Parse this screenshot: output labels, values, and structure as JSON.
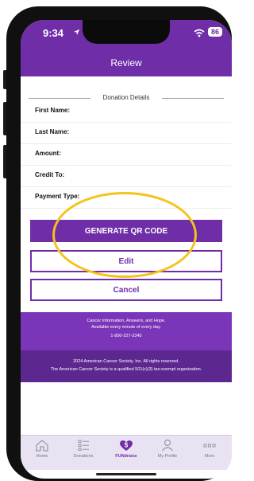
{
  "status_bar": {
    "time": "9:34",
    "battery": "86"
  },
  "header": {
    "title": "Review"
  },
  "section": {
    "title": "Donation Details"
  },
  "fields": [
    {
      "label": "First Name:",
      "value": ""
    },
    {
      "label": "Last Name:",
      "value": ""
    },
    {
      "label": "Amount:",
      "value": ""
    },
    {
      "label": "Credit To:",
      "value": ""
    },
    {
      "label": "Payment Type:",
      "value": ""
    }
  ],
  "buttons": {
    "generate_qr": "GENERATE QR CODE",
    "edit": "Edit",
    "cancel": "Cancel"
  },
  "footer": {
    "line1": "Cancer Information, Answers, and Hope.",
    "line2": "Available every minute of every day.",
    "phone": "1-800-227-2345",
    "copyright": "2024 American Cancer Society, Inc. All rights reserved.",
    "disclaimer": "The American Cancer Society is a qualified 501(c)(3) tax-exempt organization."
  },
  "tabs": [
    {
      "label": "Home",
      "icon": "home-icon"
    },
    {
      "label": "Donations",
      "icon": "list-icon"
    },
    {
      "label": "FUNdraise",
      "icon": "dollar-heart-icon",
      "active": true
    },
    {
      "label": "My Profile",
      "icon": "person-icon"
    },
    {
      "label": "More",
      "icon": "more-icon"
    }
  ],
  "colors": {
    "brand_purple": "#6f2da8",
    "highlight": "#f6c21c"
  }
}
